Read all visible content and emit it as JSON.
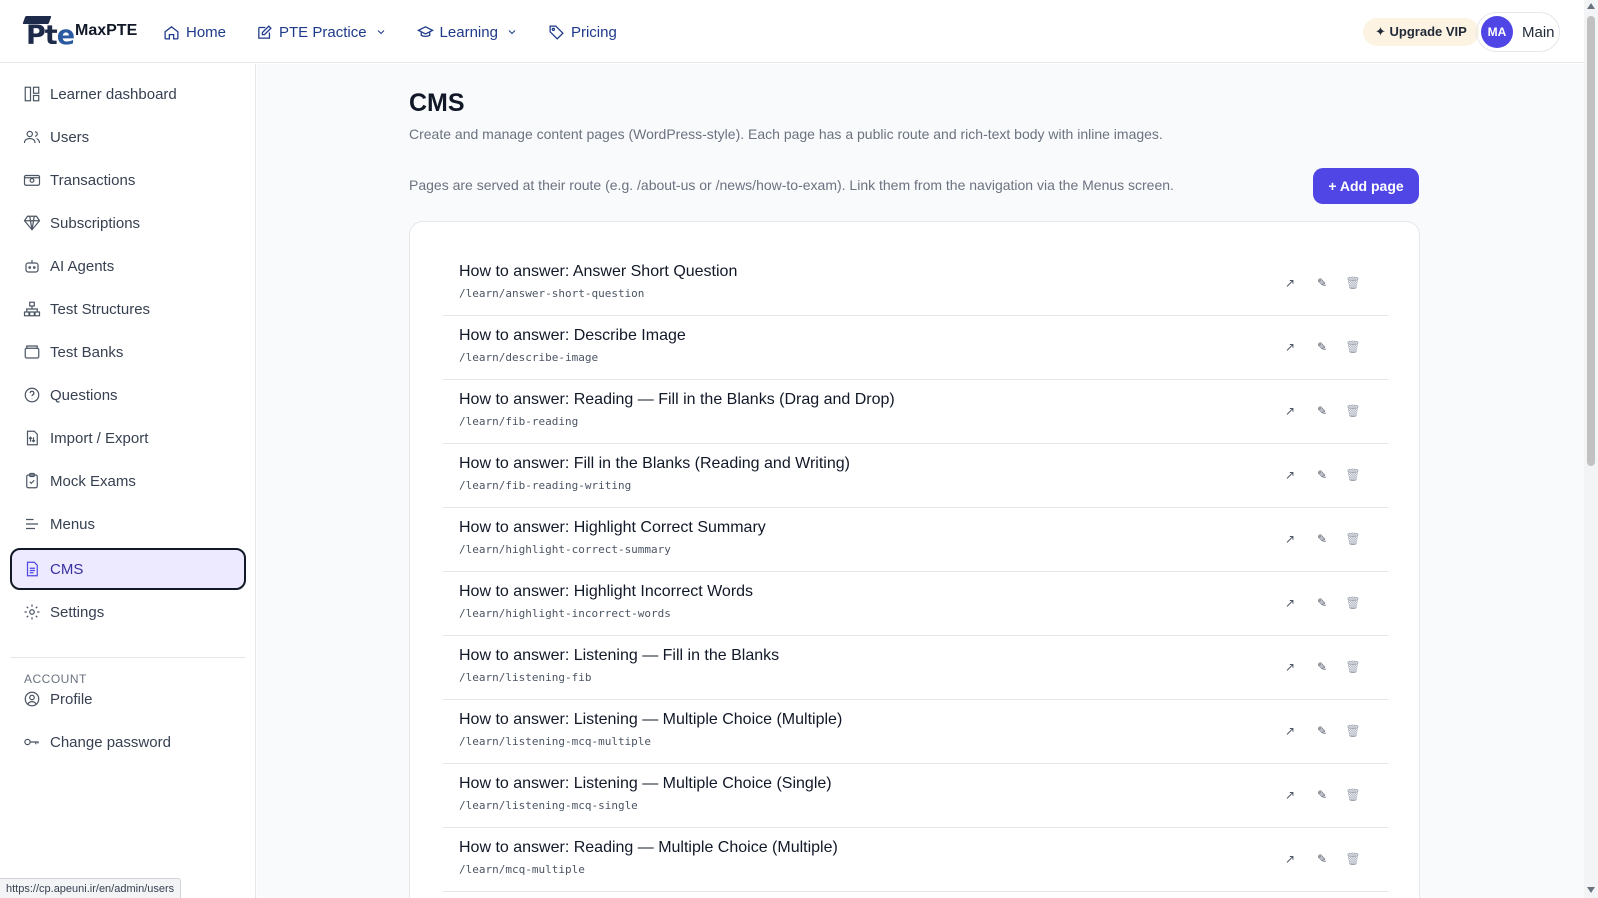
{
  "brand": {
    "name": "MaxPTE"
  },
  "nav": {
    "home": "Home",
    "practice": "PTE Practice",
    "learning": "Learning",
    "pricing": "Pricing"
  },
  "header": {
    "upgrade_label": "✦ Upgrade VIP",
    "avatar_initials": "MA",
    "user_label": "Main"
  },
  "sidebar": {
    "items": [
      {
        "label": "Learner dashboard",
        "icon": "layout-icon"
      },
      {
        "label": "Users",
        "icon": "users-icon"
      },
      {
        "label": "Transactions",
        "icon": "money-icon"
      },
      {
        "label": "Subscriptions",
        "icon": "gem-icon"
      },
      {
        "label": "AI Agents",
        "icon": "bot-icon"
      },
      {
        "label": "Test Structures",
        "icon": "hierarchy-icon"
      },
      {
        "label": "Test Banks",
        "icon": "archive-icon"
      },
      {
        "label": "Questions",
        "icon": "question-icon"
      },
      {
        "label": "Import / Export",
        "icon": "file-transfer-icon"
      },
      {
        "label": "Mock Exams",
        "icon": "clipboard-icon"
      },
      {
        "label": "Menus",
        "icon": "menu-lines-icon"
      },
      {
        "label": "CMS",
        "icon": "document-icon"
      },
      {
        "label": "Settings",
        "icon": "gear-icon"
      }
    ],
    "account_section": "ACCOUNT",
    "account_items": [
      {
        "label": "Profile",
        "icon": "user-circle-icon"
      },
      {
        "label": "Change password",
        "icon": "key-icon"
      }
    ]
  },
  "main": {
    "title": "CMS",
    "subtitle": "Create and manage content pages (WordPress-style). Each page has a public route and rich-text body with inline images.",
    "route_note": "Pages are served at their route (e.g. /about-us or /news/how-to-exam). Link them from the navigation via the Menus screen.",
    "add_button": "+ Add page",
    "pages": [
      {
        "title": "How to answer: Answer Short Question",
        "route": "/learn/answer-short-question"
      },
      {
        "title": "How to answer: Describe Image",
        "route": "/learn/describe-image"
      },
      {
        "title": "How to answer: Reading — Fill in the Blanks (Drag and Drop)",
        "route": "/learn/fib-reading"
      },
      {
        "title": "How to answer: Fill in the Blanks (Reading and Writing)",
        "route": "/learn/fib-reading-writing"
      },
      {
        "title": "How to answer: Highlight Correct Summary",
        "route": "/learn/highlight-correct-summary"
      },
      {
        "title": "How to answer: Highlight Incorrect Words",
        "route": "/learn/highlight-incorrect-words"
      },
      {
        "title": "How to answer: Listening — Fill in the Blanks",
        "route": "/learn/listening-fib"
      },
      {
        "title": "How to answer: Listening — Multiple Choice (Multiple)",
        "route": "/learn/listening-mcq-multiple"
      },
      {
        "title": "How to answer: Listening — Multiple Choice (Single)",
        "route": "/learn/listening-mcq-single"
      },
      {
        "title": "How to answer: Reading — Multiple Choice (Multiple)",
        "route": "/learn/mcq-multiple"
      }
    ],
    "actions": {
      "open": "↗",
      "edit": "✎",
      "delete": "🗑"
    }
  },
  "status_url": "https://cp.apeuni.ir/en/admin/users",
  "colors": {
    "accent": "#4f46e5",
    "active_bg": "#ede9fe",
    "upgrade_bg": "#fdf3e2"
  }
}
